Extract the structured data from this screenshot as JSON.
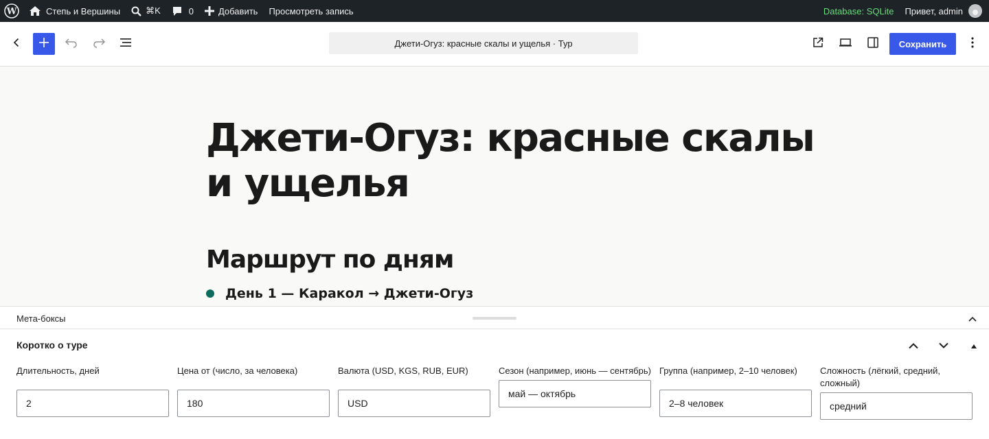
{
  "admin_bar": {
    "site_name": "Степь и Вершины",
    "search_shortcut": "⌘K",
    "comments_count": "0",
    "add_new": "Добавить",
    "view_post": "Просмотреть запись",
    "database": "Database: SQLite",
    "greeting": "Привет, admin"
  },
  "header": {
    "document_title": "Джети-Огуз: красные скалы и ущелья · Тур",
    "save_label": "Сохранить",
    "accent_color": "#3858e9"
  },
  "canvas": {
    "title": "Джети-Огуз: красные скалы и ущелья",
    "heading": "Маршрут по дням",
    "list_item": "День 1 — Каракол → Джети-Огуз"
  },
  "meta": {
    "panel_title": "Мета-боксы",
    "box_title": "Коротко о туре",
    "fields": [
      {
        "label": "Длительность, дней",
        "value": "2"
      },
      {
        "label": "Цена от (число, за человека)",
        "value": "180"
      },
      {
        "label": "Валюта (USD, KGS, RUB, EUR)",
        "value": "USD"
      },
      {
        "label": "Сезон (например, июнь — сентябрь)",
        "value": "май — октябрь"
      },
      {
        "label": "Группа (например, 2–10 человек)",
        "value": "2–8 человек"
      },
      {
        "label": "Сложность (лёгкий, средний, сложный)",
        "value": "средний"
      }
    ]
  }
}
